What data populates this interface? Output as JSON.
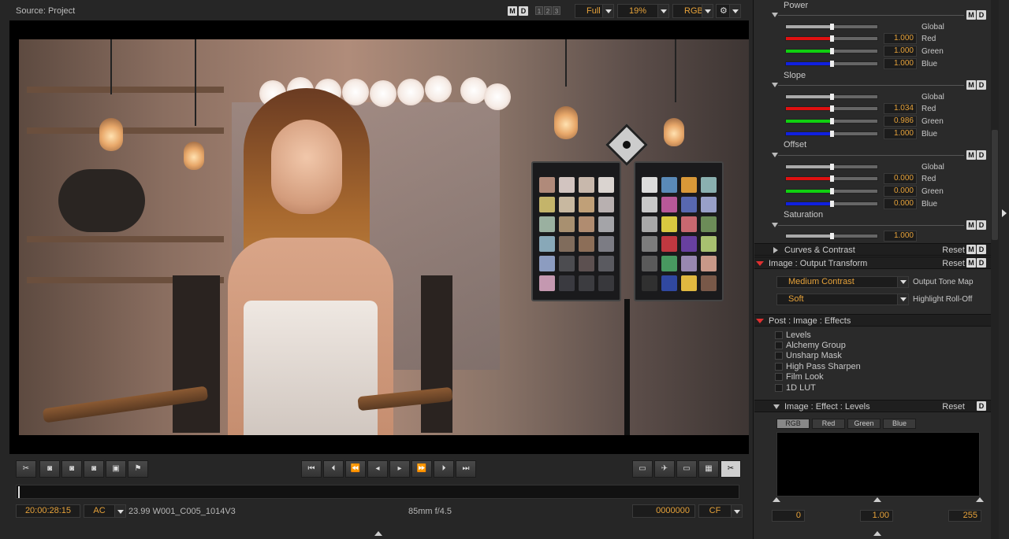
{
  "viewer": {
    "source_label": "Source: Project",
    "m_label": "M",
    "d_label": "D",
    "views": [
      "1",
      "2",
      "3"
    ],
    "quality": "Full",
    "zoom": "19%",
    "channel": "RGB"
  },
  "transport": {
    "buttons": [
      "first-frame",
      "prev-clip",
      "rewind",
      "step-back",
      "play",
      "fast-forward",
      "next-clip",
      "last-frame"
    ]
  },
  "bottom": {
    "timecode": "20:00:28:15",
    "tc_mode": "AC",
    "clip_info": "23.99 W001_C005_1014V3",
    "lens_info": "85mm  f/4.5",
    "frame": "0000000",
    "frame_mode": "CF"
  },
  "panel": {
    "m": "M",
    "d": "D",
    "reset": "Reset",
    "power": {
      "title": "Power",
      "global": "Global",
      "red": "Red",
      "green": "Green",
      "blue": "Blue",
      "red_val": "1.000",
      "green_val": "1.000",
      "blue_val": "1.000"
    },
    "slope": {
      "title": "Slope",
      "global": "Global",
      "red": "Red",
      "green": "Green",
      "blue": "Blue",
      "red_val": "1.034",
      "green_val": "0.986",
      "blue_val": "1.000"
    },
    "offset": {
      "title": "Offset",
      "global": "Global",
      "red": "Red",
      "green": "Green",
      "blue": "Blue",
      "red_val": "0.000",
      "green_val": "0.000",
      "blue_val": "0.000"
    },
    "saturation": {
      "title": "Saturation",
      "val": "1.000"
    },
    "curves": {
      "title": "Curves & Contrast"
    },
    "output": {
      "title": "Image : Output Transform",
      "tone_map": "Medium Contrast",
      "tone_map_label": "Output Tone Map",
      "rolloff": "Soft",
      "rolloff_label": "Highlight Roll-Off"
    },
    "effects": {
      "title": "Post : Image : Effects",
      "items": [
        "Levels",
        "Alchemy Group",
        "Unsharp Mask",
        "High Pass Sharpen",
        "Film Look",
        "1D LUT"
      ]
    },
    "levels": {
      "title": "Image : Effect : Levels",
      "tabs": [
        "RGB",
        "Red",
        "Green",
        "Blue"
      ],
      "low": "0",
      "mid": "1.00",
      "high": "255"
    }
  }
}
